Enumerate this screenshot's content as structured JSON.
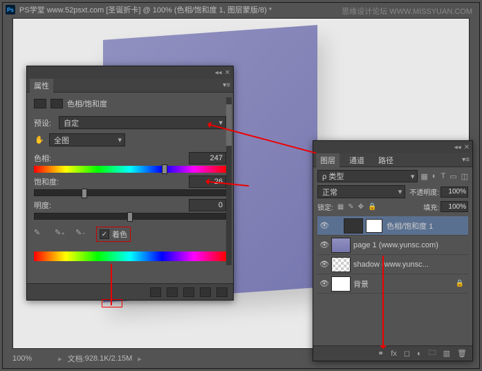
{
  "watermark": "思缘设计论坛 WWW.MISSYUAN.COM",
  "titlebar": {
    "doc": "PS学堂 www.52psxt.com [圣诞折卡] @ 100% (色相/饱和度 1, 图层蒙版/8) *"
  },
  "statusbar": {
    "zoom": "100%",
    "doc_label": "文档:",
    "doc_size": "928.1K/2.15M"
  },
  "properties_panel": {
    "title_tab": "属性",
    "adjustment_name": "色相/饱和度",
    "preset_label": "预设:",
    "preset_value": "自定",
    "range_value": "全图",
    "hue_label": "色相:",
    "hue_value": "247",
    "sat_label": "饱和度:",
    "sat_value": "26",
    "light_label": "明度:",
    "light_value": "0",
    "colorize_label": "着色"
  },
  "layers_panel": {
    "tabs": {
      "layers": "图层",
      "channels": "通道",
      "paths": "路径"
    },
    "kind_label": "ρ 类型",
    "blend_mode": "正常",
    "opacity_label": "不透明度:",
    "opacity_value": "100%",
    "lock_label": "锁定:",
    "fill_label": "填充:",
    "fill_value": "100%",
    "layers": [
      {
        "name": "色相/饱和度 1"
      },
      {
        "name": "page 1 (www.yunsc.com)"
      },
      {
        "name": "shadow (www.yunsc..."
      },
      {
        "name": "背景"
      }
    ]
  }
}
